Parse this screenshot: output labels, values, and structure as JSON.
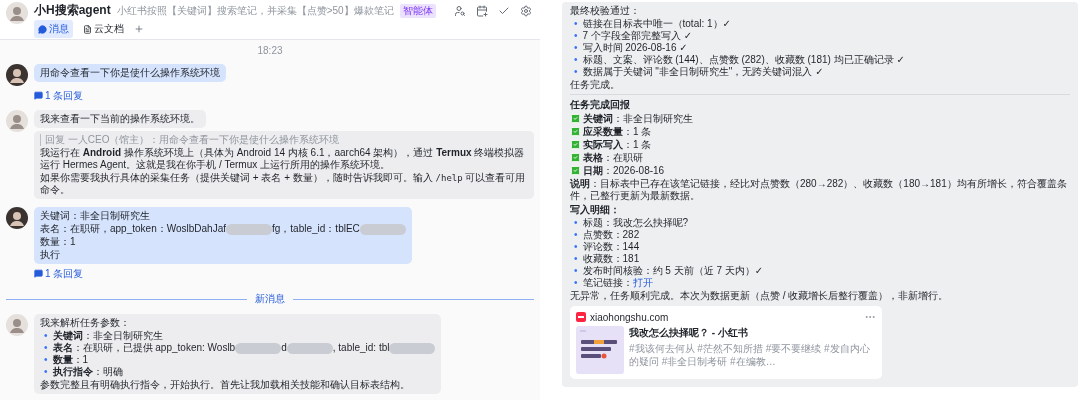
{
  "left": {
    "header": {
      "title": "小H搜索agent",
      "description": "小红书按照【关键词】搜索笔记，并采集【点赞>50】爆款笔记",
      "badge": "智能体",
      "tabs": [
        {
          "label": "消息",
          "selected": true
        },
        {
          "label": "云文档",
          "selected": false
        }
      ]
    },
    "timestamp": "18:23",
    "messages": [
      {
        "kind": "user",
        "bubbles": [
          {
            "blocks": [
              {
                "kind": "para",
                "segments": [
                  {
                    "kind": "text",
                    "text": "用命令查看一下你是使什么操作系统环境"
                  }
                ]
              }
            ]
          }
        ],
        "reply": "1 条回复"
      },
      {
        "kind": "bot",
        "bubbles": [
          {
            "blocks": [
              {
                "kind": "para",
                "segments": [
                  {
                    "kind": "text",
                    "text": "我来查看一下当前的操作系统环境。"
                  }
                ]
              }
            ]
          },
          {
            "blocks": [
              {
                "kind": "quote",
                "text": "回复 一人CEO（馆主）：用命令查看一下你是使什么操作系统环境"
              },
              {
                "kind": "para",
                "segments": [
                  {
                    "kind": "text",
                    "text": "我运行在 **Android** 操作系统环境上（具体为 Android 14 内核 6.1，aarch64 架构），通过 **Termux** 终端模拟器运行 Hermes Agent。这就是我在你手机 / Termux 上运行所用的操作系统环境。"
                  }
                ]
              },
              {
                "kind": "para",
                "segments": [
                  {
                    "kind": "text",
                    "text": "如果你需要我执行具体的采集任务（提供关键词 + 表名 + 数量），随时告诉我即可。输入 "
                  },
                  {
                    "kind": "code",
                    "text": "/help"
                  },
                  {
                    "kind": "text",
                    "text": " 可以查看可用命令。"
                  }
                ]
              }
            ]
          }
        ]
      },
      {
        "kind": "user",
        "bubbles": [
          {
            "blocks": [
              {
                "kind": "para",
                "segments": [
                  {
                    "kind": "text",
                    "text": "关键词：非全日制研究生"
                  }
                ]
              },
              {
                "kind": "para",
                "segments": [
                  {
                    "kind": "text",
                    "text": "表名：在职研，app_token：WoslbDahJaf"
                  },
                  {
                    "kind": "redacted"
                  },
                  {
                    "kind": "text",
                    "text": "fg，table_id：tblEC"
                  },
                  {
                    "kind": "redacted"
                  }
                ]
              },
              {
                "kind": "para",
                "segments": [
                  {
                    "kind": "text",
                    "text": "数量：1"
                  }
                ]
              },
              {
                "kind": "para",
                "segments": [
                  {
                    "kind": "text",
                    "text": "执行"
                  }
                ]
              }
            ]
          }
        ],
        "reply": "1 条回复"
      },
      {
        "kind": "divider",
        "text": "新消息"
      },
      {
        "kind": "bot",
        "bubbles": [
          {
            "blocks": [
              {
                "kind": "para",
                "segments": [
                  {
                    "kind": "text",
                    "text": "我来解析任务参数："
                  }
                ]
              },
              {
                "kind": "bullets",
                "marker": "•",
                "items": [
                  {
                    "segments": [
                      {
                        "kind": "text",
                        "text": "**关键词**：非全日制研究生"
                      }
                    ]
                  },
                  {
                    "segments": [
                      {
                        "kind": "text",
                        "text": "**表名**：在职研，已提供 app_token: Woslb"
                      },
                      {
                        "kind": "redacted"
                      },
                      {
                        "kind": "text",
                        "text": "d"
                      },
                      {
                        "kind": "redacted"
                      },
                      {
                        "kind": "text",
                        "text": ", table_id: tbl"
                      },
                      {
                        "kind": "redacted"
                      }
                    ]
                  },
                  {
                    "segments": [
                      {
                        "kind": "text",
                        "text": "**数量**：1"
                      }
                    ]
                  },
                  {
                    "segments": [
                      {
                        "kind": "text",
                        "text": "**执行指令**：明确"
                      }
                    ]
                  }
                ]
              },
              {
                "kind": "para",
                "segments": [
                  {
                    "kind": "text",
                    "text": "参数完整且有明确执行指令，开始执行。首先让我加载相关技能和确认目标表结构。"
                  }
                ]
              }
            ]
          }
        ]
      }
    ]
  },
  "right": {
    "blocks": [
      {
        "kind": "para",
        "segments": [
          {
            "kind": "text",
            "text": "最终校验通过："
          }
        ]
      },
      {
        "kind": "bullets",
        "marker": "•",
        "items": [
          {
            "segments": [
              {
                "kind": "text",
                "text": "链接在目标表中唯一（total: 1）✓"
              }
            ]
          },
          {
            "segments": [
              {
                "kind": "text",
                "text": "7 个字段全部完整写入 ✓"
              }
            ]
          },
          {
            "segments": [
              {
                "kind": "text",
                "text": "写入时间 2026-08-16 ✓"
              }
            ]
          },
          {
            "segments": [
              {
                "kind": "text",
                "text": "标题、文案、评论数 (144)、点赞数 (282)、收藏数 (181) 均已正确记录 ✓"
              }
            ]
          },
          {
            "segments": [
              {
                "kind": "text",
                "text": "数据属于关键词 \"非全日制研究生\"，无跨关键词混入 ✓"
              }
            ]
          }
        ]
      },
      {
        "kind": "para",
        "segments": [
          {
            "kind": "text",
            "text": "任务完成。"
          }
        ]
      },
      {
        "kind": "rule"
      },
      {
        "kind": "heading",
        "text": "任务完成回报"
      },
      {
        "kind": "checks",
        "items": [
          {
            "checked": true,
            "text": "**关键词**：非全日制研究生"
          },
          {
            "checked": true,
            "text": "**应采数量**：1 条"
          },
          {
            "checked": true,
            "text": "**实际写入**：1 条"
          },
          {
            "checked": true,
            "text": "**表格**：在职研"
          },
          {
            "checked": true,
            "text": "**日期**：2026-08-16"
          }
        ]
      },
      {
        "kind": "para",
        "segments": [
          {
            "kind": "text",
            "text": "**说明**：目标表中已存在该笔记链接，经比对点赞数（280→282）、收藏数（180→181）均有所增长，符合覆盖条件，已整行更新为最新数据。"
          }
        ]
      },
      {
        "kind": "heading",
        "text": "写入明细："
      },
      {
        "kind": "bullets",
        "marker": "•",
        "items": [
          {
            "segments": [
              {
                "kind": "text",
                "text": "标题：我改怎么抉择呢?"
              }
            ]
          },
          {
            "segments": [
              {
                "kind": "text",
                "text": "点赞数：282"
              }
            ]
          },
          {
            "segments": [
              {
                "kind": "text",
                "text": "评论数：144"
              }
            ]
          },
          {
            "segments": [
              {
                "kind": "text",
                "text": "收藏数：181"
              }
            ]
          },
          {
            "segments": [
              {
                "kind": "text",
                "text": "发布时间核验：约 5 天前（近 7 天内）✓"
              }
            ]
          },
          {
            "segments": [
              {
                "kind": "text",
                "text": "笔记链接："
              },
              {
                "kind": "link",
                "text": "打开"
              }
            ]
          }
        ]
      },
      {
        "kind": "para",
        "segments": [
          {
            "kind": "text",
            "text": "无异常，任务顺利完成。本次为数据更新（点赞 / 收藏增长后整行覆盖），非新增行。"
          }
        ]
      },
      {
        "kind": "card",
        "site": "xiaohongshu.com",
        "title": "我改怎么抉择呢？ - 小红书",
        "description": "#我该何去何从 #茫然不知所措 #要不要继续 #发自内心的疑问 #非全日制考研 #在编教…"
      }
    ]
  }
}
